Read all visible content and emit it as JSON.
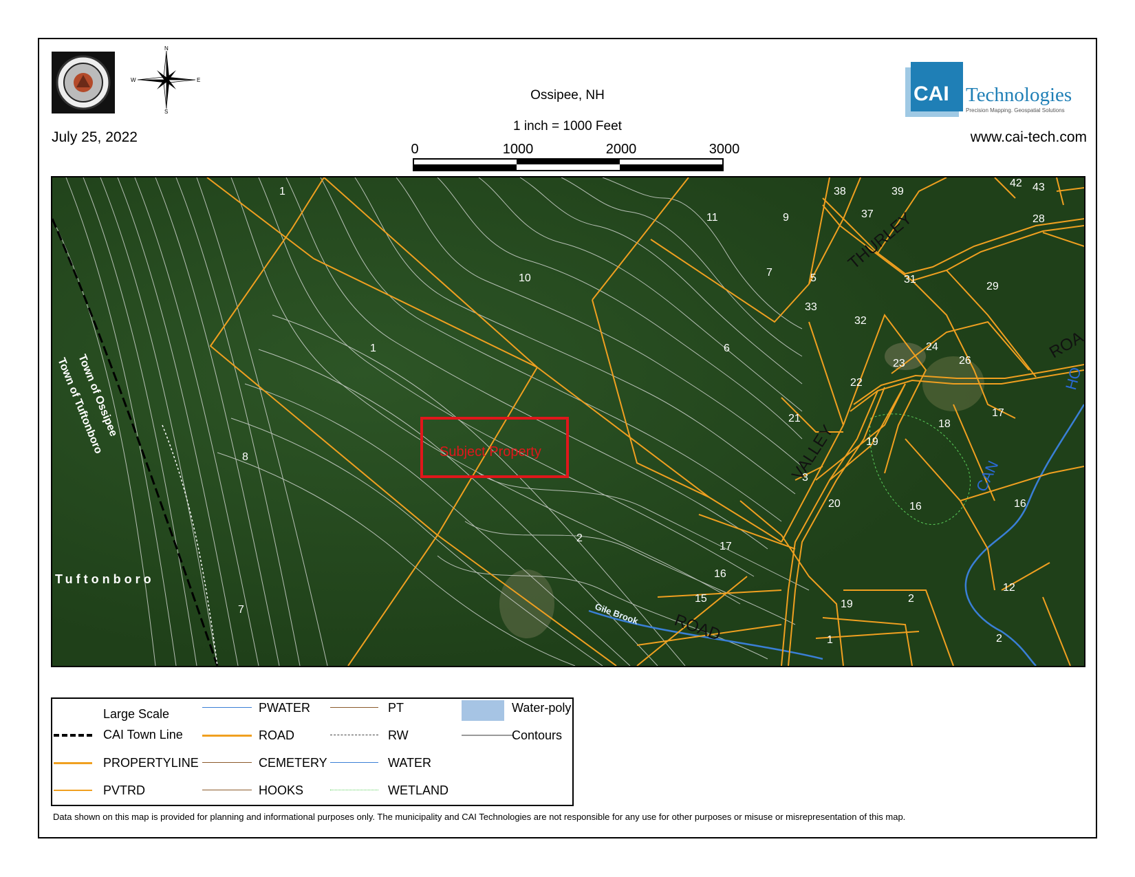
{
  "header": {
    "title": "Ossipee, NH",
    "date": "July 25, 2022",
    "scale_text": "1 inch = 1000 Feet",
    "scale_ticks": [
      "0",
      "1000",
      "2000",
      "3000"
    ],
    "seal_icon": "town-seal-icon",
    "compass_icon": "north-arrow-icon",
    "compass_letters": {
      "n": "N",
      "s": "S",
      "e": "E",
      "w": "W"
    }
  },
  "brand": {
    "name_bold": "CAI",
    "name_rest": "Technologies",
    "tagline": "Precision Mapping. Geospatial Solutions",
    "url": "www.cai-tech.com",
    "color": "#1f7fb6"
  },
  "map": {
    "subject_label": "Subject Property",
    "subject_color": "#e0171b",
    "imagery_color": "#24491f",
    "parcel_line_color": "#f0a020",
    "contour_color": "#e8e8e8",
    "town_labels": {
      "town_of_ossipee": "Town of Ossipee",
      "town_of_tuftonboro": "Town of Tuftonboro",
      "tuftonboro": "Tuftonboro"
    },
    "road_labels": [
      "THURLEY",
      "VALLEY",
      "ROAD",
      "ROA",
      "CAN",
      "HO"
    ],
    "water_label": "Gile Brook",
    "parcel_labels": [
      "1",
      "1",
      "10",
      "11",
      "9",
      "7",
      "5",
      "33",
      "38",
      "37",
      "39",
      "42",
      "43",
      "28",
      "31",
      "29",
      "32",
      "24",
      "26",
      "23",
      "22",
      "6",
      "21",
      "18",
      "17",
      "19",
      "3",
      "20",
      "16",
      "16",
      "8",
      "2",
      "17",
      "16",
      "15",
      "19",
      "1",
      "2",
      "12",
      "2",
      "7"
    ]
  },
  "legend": {
    "items": [
      {
        "label": "Large Scale",
        "symbol": "none"
      },
      {
        "label": "CAI Town Line",
        "symbol": "dashed-black-thick"
      },
      {
        "label": "PROPERTYLINE",
        "symbol": "orange-thick"
      },
      {
        "label": "PVTRD",
        "symbol": "orange"
      },
      {
        "label": "PWATER",
        "symbol": "blue-thin"
      },
      {
        "label": "ROAD",
        "symbol": "orange-thick"
      },
      {
        "label": "CEMETERY",
        "symbol": "brown-thin"
      },
      {
        "label": "HOOKS",
        "symbol": "brown-thin"
      },
      {
        "label": "PT",
        "symbol": "brown-thin"
      },
      {
        "label": "RW",
        "symbol": "dashed-gray"
      },
      {
        "label": "WATER",
        "symbol": "blue-thin"
      },
      {
        "label": "WETLAND",
        "symbol": "green-dotted"
      },
      {
        "label": "Water-poly",
        "symbol": "light-blue-box"
      },
      {
        "label": "Contours",
        "symbol": "gray-line"
      }
    ]
  },
  "footer": {
    "disclaimer": "Data shown on this map is provided for planning and informational purposes only. The municipality and CAI Technologies are not responsible for any use for other purposes or misuse or misrepresentation of this map."
  }
}
